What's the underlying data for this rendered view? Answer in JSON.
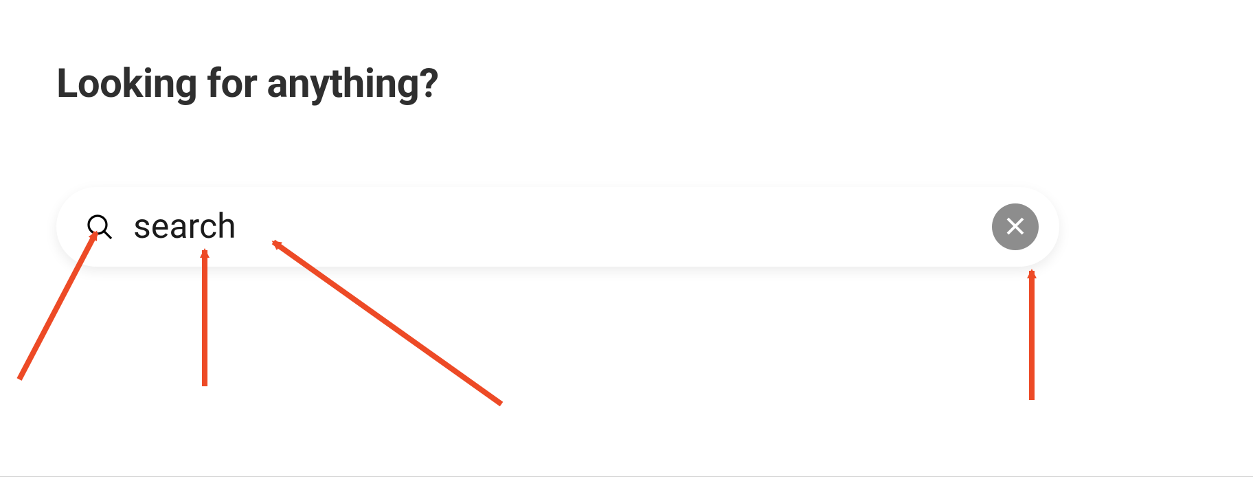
{
  "heading": "Looking for anything?",
  "search": {
    "value": "search",
    "placeholder": ""
  },
  "annotations": {
    "color": "#ed4a26"
  }
}
